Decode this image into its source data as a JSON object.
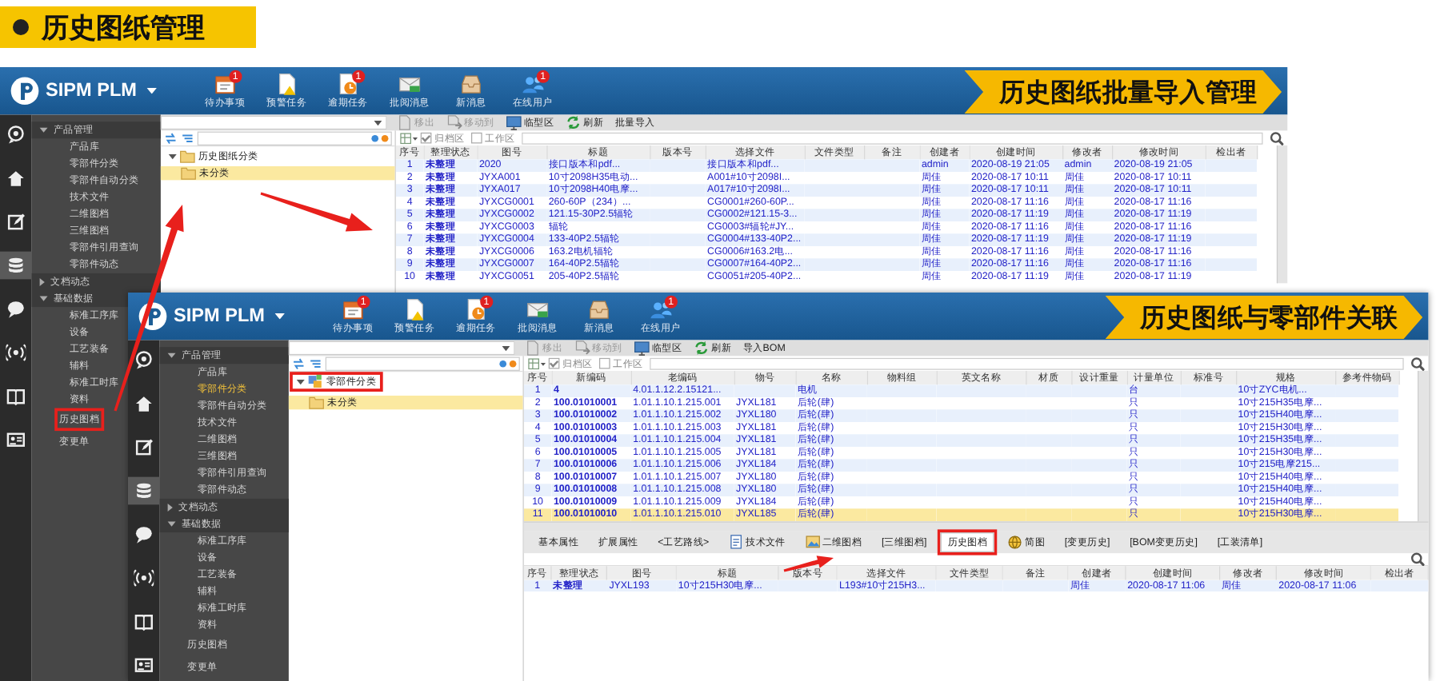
{
  "slide": {
    "title": "历史图纸管理"
  },
  "windows": [
    {
      "logo": "SIPM PLM",
      "toolbar": [
        {
          "label": "待办事项",
          "badge": "1"
        },
        {
          "label": "预警任务"
        },
        {
          "label": "逾期任务",
          "badge": "1"
        },
        {
          "label": "批阅消息"
        },
        {
          "label": "新消息"
        },
        {
          "label": "在线用户",
          "badge": "1"
        }
      ],
      "banner": "历史图纸批量导入管理",
      "rail": [
        {
          "selected": false
        },
        {
          "selected": false
        },
        {
          "selected": false
        },
        {
          "selected": true
        },
        {
          "selected": false
        },
        {
          "selected": false
        },
        {
          "selected": false
        },
        {
          "selected": false
        }
      ],
      "sidebar": [
        {
          "kind": "group",
          "label": "产品管理",
          "expanded": true,
          "marked": false,
          "children": [
            {
              "label": "产品库",
              "selected": false
            },
            {
              "label": "零部件分类",
              "selected": false
            },
            {
              "label": "零部件自动分类",
              "selected": false
            },
            {
              "label": "技术文件",
              "selected": false
            },
            {
              "label": "二维图档",
              "selected": false
            },
            {
              "label": "三维图档",
              "selected": false
            },
            {
              "label": "零部件引用查询",
              "selected": false
            },
            {
              "label": "零部件动态",
              "selected": false
            }
          ]
        },
        {
          "kind": "group",
          "label": "文档动态",
          "expanded": false,
          "marked": false
        },
        {
          "kind": "group",
          "label": "基础数据",
          "expanded": true,
          "marked": false,
          "children": [
            {
              "label": "标准工序库",
              "selected": false
            },
            {
              "label": "设备",
              "selected": false
            },
            {
              "label": "工艺装备",
              "selected": false
            },
            {
              "label": "辅料",
              "selected": false
            },
            {
              "label": "标准工时库",
              "selected": false
            },
            {
              "label": "资料",
              "selected": false
            }
          ]
        },
        {
          "kind": "link",
          "label": "历史图档",
          "selected": false,
          "marked": true
        },
        {
          "kind": "link",
          "label": "变更单",
          "selected": false,
          "marked": false
        }
      ],
      "actions": [
        {
          "label": "移出",
          "disabled": true
        },
        {
          "label": "移动到",
          "disabled": true
        },
        {
          "label": "临型区",
          "disabled": false
        },
        {
          "label": "刷新",
          "disabled": false
        },
        {
          "label": "批量导入",
          "disabled": false
        }
      ],
      "tree": {
        "label": "历史图纸分类",
        "expanded": true,
        "marked": false,
        "children": [
          {
            "label": "未分类",
            "selected": true
          }
        ]
      },
      "filters": [
        {
          "label": "归档区",
          "checked": true
        },
        {
          "label": "工作区",
          "checked": false
        }
      ],
      "table": {
        "columns": [
          "序号",
          "整理状态",
          "图号",
          "标题",
          "版本号",
          "选择文件",
          "文件类型",
          "备注",
          "创建者",
          "创建时间",
          "修改者",
          "修改时间",
          "检出者"
        ],
        "rows": [
          {
            "selected": false,
            "cells": [
              "1",
              "未整理",
              "2020",
              "接口版本和pdf...",
              null,
              "接口版本和pdf...",
              null,
              null,
              "admin",
              "2020-08-19 21:05",
              "admin",
              "2020-08-19 21:05",
              null
            ]
          },
          {
            "selected": false,
            "cells": [
              "2",
              "未整理",
              "JYXA001",
              "10寸2098H35电动...",
              null,
              "A001#10寸2098I...",
              null,
              null,
              "周佳",
              "2020-08-17 10:11",
              "周佳",
              "2020-08-17 10:11",
              null
            ]
          },
          {
            "selected": false,
            "cells": [
              "3",
              "未整理",
              "JYXA017",
              "10寸2098H40电摩...",
              null,
              "A017#10寸2098I...",
              null,
              null,
              "周佳",
              "2020-08-17 10:11",
              "周佳",
              "2020-08-17 10:11",
              null
            ]
          },
          {
            "selected": false,
            "cells": [
              "4",
              "未整理",
              "JYXCG0001",
              "260-60P（234）...",
              null,
              "CG0001#260-60P...",
              null,
              null,
              "周佳",
              "2020-08-17 11:16",
              "周佳",
              "2020-08-17 11:16",
              null
            ]
          },
          {
            "selected": false,
            "cells": [
              "5",
              "未整理",
              "JYXCG0002",
              "121.15-30P2.5辐轮",
              null,
              "CG0002#121.15-3...",
              null,
              null,
              "周佳",
              "2020-08-17 11:19",
              "周佳",
              "2020-08-17 11:19",
              null
            ]
          },
          {
            "selected": false,
            "cells": [
              "6",
              "未整理",
              "JYXCG0003",
              "辐轮",
              null,
              "CG0003#辐轮#JY...",
              null,
              null,
              "周佳",
              "2020-08-17 11:16",
              "周佳",
              "2020-08-17 11:16",
              null
            ]
          },
          {
            "selected": false,
            "cells": [
              "7",
              "未整理",
              "JYXCG0004",
              "133-40P2.5辐轮",
              null,
              "CG0004#133-40P2...",
              null,
              null,
              "周佳",
              "2020-08-17 11:19",
              "周佳",
              "2020-08-17 11:19",
              null
            ]
          },
          {
            "selected": false,
            "cells": [
              "8",
              "未整理",
              "JYXCG0006",
              "163.2电机辐轮",
              null,
              "CG0006#163.2电...",
              null,
              null,
              "周佳",
              "2020-08-17 11:16",
              "周佳",
              "2020-08-17 11:16",
              null
            ]
          },
          {
            "selected": false,
            "cells": [
              "9",
              "未整理",
              "JYXCG0007",
              "164-40P2.5辐轮",
              null,
              "CG0007#164-40P2...",
              null,
              null,
              "周佳",
              "2020-08-17 11:16",
              "周佳",
              "2020-08-17 11:16",
              null
            ]
          },
          {
            "selected": false,
            "cells": [
              "10",
              "未整理",
              "JYXCG0051",
              "205-40P2.5辐轮",
              null,
              "CG0051#205-40P2...",
              null,
              null,
              "周佳",
              "2020-08-17 11:19",
              "周佳",
              "2020-08-17 11:19",
              null
            ]
          }
        ]
      }
    },
    {
      "logo": "SIPM PLM",
      "toolbar": [
        {
          "label": "待办事项",
          "badge": "1"
        },
        {
          "label": "预警任务"
        },
        {
          "label": "逾期任务",
          "badge": "1"
        },
        {
          "label": "批阅消息"
        },
        {
          "label": "新消息"
        },
        {
          "label": "在线用户",
          "badge": "1"
        }
      ],
      "banner": "历史图纸与零部件关联",
      "rail": [
        {
          "selected": false
        },
        {
          "selected": false
        },
        {
          "selected": false
        },
        {
          "selected": true
        },
        {
          "selected": false
        },
        {
          "selected": false
        },
        {
          "selected": false
        },
        {
          "selected": false
        }
      ],
      "sidebar": [
        {
          "kind": "group",
          "label": "产品管理",
          "expanded": true,
          "marked": false,
          "children": [
            {
              "label": "产品库",
              "selected": false
            },
            {
              "label": "零部件分类",
              "selected": true
            },
            {
              "label": "零部件自动分类",
              "selected": false
            },
            {
              "label": "技术文件",
              "selected": false
            },
            {
              "label": "二维图档",
              "selected": false
            },
            {
              "label": "三维图档",
              "selected": false
            },
            {
              "label": "零部件引用查询",
              "selected": false
            },
            {
              "label": "零部件动态",
              "selected": false
            }
          ]
        },
        {
          "kind": "group",
          "label": "文档动态",
          "expanded": false,
          "marked": false
        },
        {
          "kind": "group",
          "label": "基础数据",
          "expanded": true,
          "marked": false,
          "children": [
            {
              "label": "标准工序库",
              "selected": false
            },
            {
              "label": "设备",
              "selected": false
            },
            {
              "label": "工艺装备",
              "selected": false
            },
            {
              "label": "辅料",
              "selected": false
            },
            {
              "label": "标准工时库",
              "selected": false
            },
            {
              "label": "资料",
              "selected": false
            }
          ]
        },
        {
          "kind": "link",
          "label": "历史图档",
          "selected": false,
          "marked": false
        },
        {
          "kind": "link",
          "label": "变更单",
          "selected": false,
          "marked": false
        }
      ],
      "actions": [
        {
          "label": "移出",
          "disabled": true
        },
        {
          "label": "移动到",
          "disabled": true
        },
        {
          "label": "临型区",
          "disabled": false
        },
        {
          "label": "刷新",
          "disabled": false
        },
        {
          "label": "导入BOM",
          "disabled": false
        }
      ],
      "tree": {
        "label": "零部件分类",
        "expanded": true,
        "marked": true,
        "children": [
          {
            "label": "未分类",
            "selected": true
          }
        ]
      },
      "filters": [
        {
          "label": "归档区",
          "checked": true
        },
        {
          "label": "工作区",
          "checked": false
        }
      ],
      "table": {
        "columns": [
          "序号",
          "新编码",
          "老编码",
          "物号",
          "名称",
          "物料组",
          "英文名称",
          "材质",
          "设计重量",
          "计量单位",
          "标准号",
          "规格",
          "参考件物码"
        ],
        "rows": [
          {
            "selected": false,
            "cells": [
              "1",
              "4",
              "4.01.1.12.2.15121...",
              null,
              "电机",
              null,
              null,
              null,
              null,
              "台",
              null,
              "10寸ZYC电机...",
              null
            ]
          },
          {
            "selected": false,
            "cells": [
              "2",
              "100.01010001",
              "1.01.1.10.1.215.001",
              "JYXL181",
              "后轮(肆)",
              null,
              null,
              null,
              null,
              "只",
              null,
              "10寸215H35电摩...",
              null
            ]
          },
          {
            "selected": false,
            "cells": [
              "3",
              "100.01010002",
              "1.01.1.10.1.215.002",
              "JYXL180",
              "后轮(肆)",
              null,
              null,
              null,
              null,
              "只",
              null,
              "10寸215H40电摩...",
              null
            ]
          },
          {
            "selected": false,
            "cells": [
              "4",
              "100.01010003",
              "1.01.1.10.1.215.003",
              "JYXL181",
              "后轮(肆)",
              null,
              null,
              null,
              null,
              "只",
              null,
              "10寸215H30电摩...",
              null
            ]
          },
          {
            "selected": false,
            "cells": [
              "5",
              "100.01010004",
              "1.01.1.10.1.215.004",
              "JYXL181",
              "后轮(肆)",
              null,
              null,
              null,
              null,
              "只",
              null,
              "10寸215H35电摩...",
              null
            ]
          },
          {
            "selected": false,
            "cells": [
              "6",
              "100.01010005",
              "1.01.1.10.1.215.005",
              "JYXL181",
              "后轮(肆)",
              null,
              null,
              null,
              null,
              "只",
              null,
              "10寸215H30电摩...",
              null
            ]
          },
          {
            "selected": false,
            "cells": [
              "7",
              "100.01010006",
              "1.01.1.10.1.215.006",
              "JYXL184",
              "后轮(肆)",
              null,
              null,
              null,
              null,
              "只",
              null,
              "10寸215电摩215...",
              null
            ]
          },
          {
            "selected": false,
            "cells": [
              "8",
              "100.01010007",
              "1.01.1.10.1.215.007",
              "JYXL180",
              "后轮(肆)",
              null,
              null,
              null,
              null,
              "只",
              null,
              "10寸215H40电摩...",
              null
            ]
          },
          {
            "selected": false,
            "cells": [
              "9",
              "100.01010008",
              "1.01.1.10.1.215.008",
              "JYXL180",
              "后轮(肆)",
              null,
              null,
              null,
              null,
              "只",
              null,
              "10寸215H40电摩...",
              null
            ]
          },
          {
            "selected": false,
            "cells": [
              "10",
              "100.01010009",
              "1.01.1.10.1.215.009",
              "JYXL184",
              "后轮(肆)",
              null,
              null,
              null,
              null,
              "只",
              null,
              "10寸215H40电摩...",
              null
            ]
          },
          {
            "selected": true,
            "cells": [
              "11",
              "100.01010010",
              "1.01.1.10.1.215.010",
              "JYXL185",
              "后轮(肆)",
              null,
              null,
              null,
              null,
              "只",
              null,
              "10寸215H30电摩...",
              null
            ]
          }
        ]
      },
      "detail": {
        "tabs": [
          {
            "label": "基本属性",
            "selected": false,
            "marked": false
          },
          {
            "label": "扩展属性",
            "selected": false,
            "marked": false
          },
          {
            "label": "<工艺路线>",
            "selected": false,
            "marked": false
          },
          {
            "label": "技术文件",
            "selected": false,
            "marked": false
          },
          {
            "label": "二维图档",
            "selected": false,
            "marked": false
          },
          {
            "label": "[三维图档]",
            "selected": false,
            "marked": false
          },
          {
            "label": "历史图档",
            "selected": true,
            "marked": true
          },
          {
            "label": "简图",
            "selected": false,
            "marked": false
          },
          {
            "label": "[变更历史]",
            "selected": false,
            "marked": false
          },
          {
            "label": "[BOM变更历史]",
            "selected": false,
            "marked": false
          },
          {
            "label": "[工装清单]",
            "selected": false,
            "marked": false
          }
        ],
        "table": {
          "columns": [
            "序号",
            "整理状态",
            "图号",
            "标题",
            "版本号",
            "选择文件",
            "文件类型",
            "备注",
            "创建者",
            "创建时间",
            "修改者",
            "修改时间",
            "检出者"
          ],
          "rows": [
            {
              "selected": false,
              "cells": [
                "1",
                "未整理",
                "JYXL193",
                "10寸215H30电摩...",
                null,
                "L193#10寸215H3...",
                null,
                null,
                "周佳",
                "2020-08-17 11:06",
                "周佳",
                "2020-08-17 11:06",
                null
              ]
            }
          ]
        }
      }
    }
  ]
}
